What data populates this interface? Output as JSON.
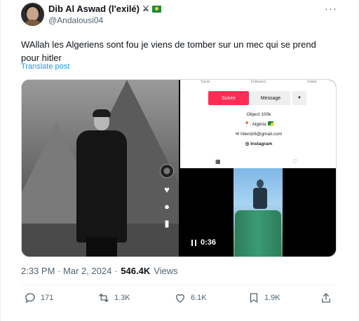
{
  "author": {
    "display_name": "Dib Al Aswad (l'exilé)",
    "handle": "@Andalousi04",
    "badges": [
      "crossed-swords-icon",
      "algeria-flag-icon"
    ]
  },
  "tweet": {
    "text": "WAllah les Algeriens sont fou je viens de tomber sur un mec qui se prend pour hitler",
    "translate_label": "Translate post",
    "timestamp": "2:33 PM · Mar 2, 2024 · ",
    "views_count": "546.4K",
    "views_label": "Views"
  },
  "media": {
    "profile_screenshot": {
      "stats_labels": [
        "Suivis",
        "Followers",
        "J'aime"
      ],
      "follow_button": "Suivre",
      "message_button": "Message",
      "bio_line1": "Object 100k",
      "bio_line2": "📍: Algéria",
      "bio_line3": "hilerdz6@gmail.com",
      "bio_line4": "Instagram"
    },
    "video_time": "0:36"
  },
  "actions": {
    "reply_count": "171",
    "retweet_count": "1.3K",
    "like_count": "6.1K",
    "bookmark_count": "1.9K"
  },
  "colors": {
    "accent": "#1d9bf0",
    "tiktok_red": "#fe2c55",
    "muted_text": "#536471"
  }
}
